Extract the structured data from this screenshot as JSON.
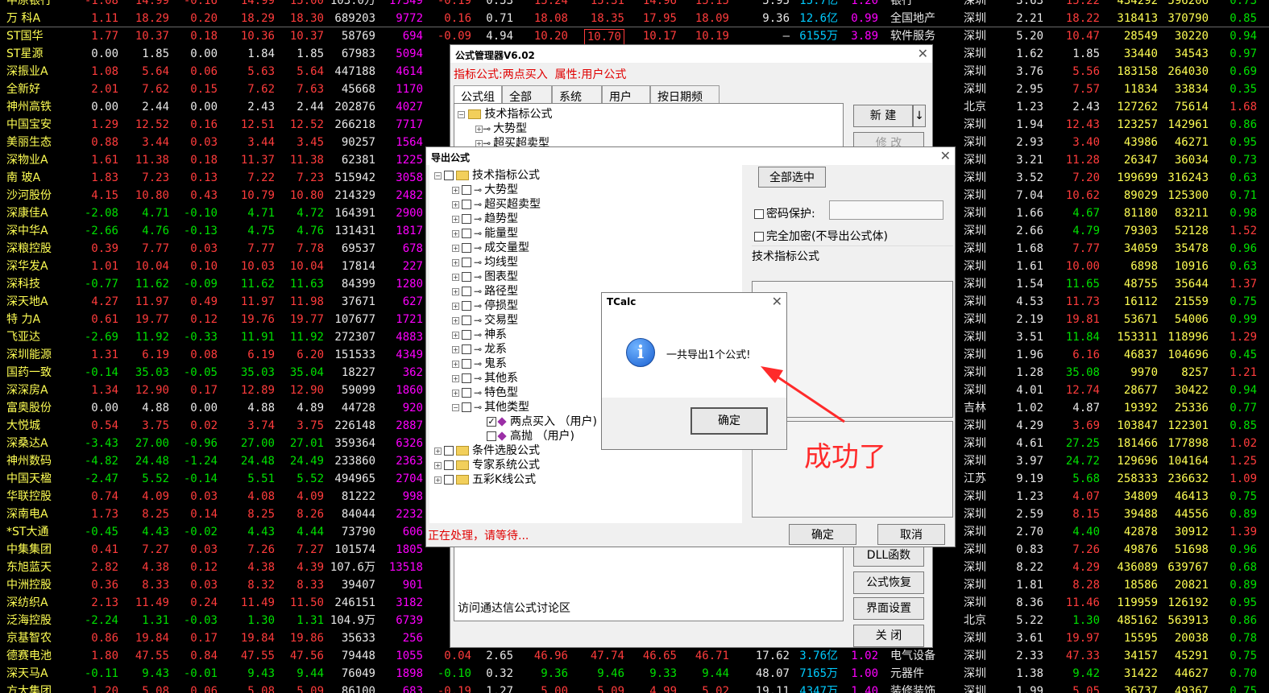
{
  "quotes": {
    "rows": [
      {
        "n": "中原银行",
        "v": [
          "-1.08",
          "14.99",
          "-0.16",
          "14.99",
          "15.00",
          "103.0万",
          "17349",
          "-0.19",
          "0.53",
          "15.24",
          "15.31",
          "14.96",
          "15.15",
          "5.95",
          "15.7亿",
          "1.20"
        ],
        "ind": "银行",
        "reg": "深圳",
        "t": [
          "3.63",
          "15.22",
          "434292",
          "596206",
          "0.73"
        ],
        "c": "r"
      },
      {
        "n": "万 科A",
        "v": [
          "1.11",
          "18.29",
          "0.20",
          "18.29",
          "18.30",
          "689203",
          "9772",
          "0.16",
          "0.71",
          "18.08",
          "18.35",
          "17.95",
          "18.09",
          "9.36",
          "12.6亿",
          "0.99"
        ],
        "ind": "全国地产",
        "reg": "深圳",
        "t": [
          "2.21",
          "18.22",
          "318413",
          "370790",
          "0.85"
        ],
        "c": "r"
      },
      {
        "n": "ST国华",
        "v": [
          "1.77",
          "10.37",
          "0.18",
          "10.36",
          "10.37",
          "58769",
          "694",
          "-0.09",
          "4.94",
          "10.20",
          "10.70",
          "10.17",
          "10.19",
          "—",
          "6155万",
          "3.89"
        ],
        "ind": "软件服务",
        "reg": "深圳",
        "t": [
          "5.20",
          "10.47",
          "28549",
          "30220",
          "0.94"
        ],
        "c": "r"
      },
      {
        "n": "ST星源",
        "v": [
          "0.00",
          "1.85",
          "0.00",
          "1.84",
          "1.85",
          "67983",
          "5094"
        ],
        "reg": "深圳",
        "t": [
          "1.62",
          "1.85",
          "33440",
          "34543",
          "0.97"
        ],
        "c": "w"
      },
      {
        "n": "深振业A",
        "v": [
          "1.08",
          "5.64",
          "0.06",
          "5.63",
          "5.64",
          "447188",
          "4614"
        ],
        "reg": "深圳",
        "t": [
          "3.76",
          "5.56",
          "183158",
          "264030",
          "0.69"
        ],
        "c": "r"
      },
      {
        "n": "全新好",
        "v": [
          "2.01",
          "7.62",
          "0.15",
          "7.62",
          "7.63",
          "45668",
          "1170"
        ],
        "reg": "深圳",
        "t": [
          "2.95",
          "7.57",
          "11834",
          "33834",
          "0.35"
        ],
        "c": "r"
      },
      {
        "n": "神州高铁",
        "v": [
          "0.00",
          "2.44",
          "0.00",
          "2.43",
          "2.44",
          "202876",
          "4027"
        ],
        "reg": "北京",
        "t": [
          "1.23",
          "2.43",
          "127262",
          "75614",
          "1.68"
        ],
        "c": "w"
      },
      {
        "n": "中国宝安",
        "v": [
          "1.29",
          "12.52",
          "0.16",
          "12.51",
          "12.52",
          "266218",
          "7717"
        ],
        "reg": "深圳",
        "t": [
          "1.94",
          "12.43",
          "123257",
          "142961",
          "0.86"
        ],
        "c": "r"
      },
      {
        "n": "美丽生态",
        "v": [
          "0.88",
          "3.44",
          "0.03",
          "3.44",
          "3.45",
          "90257",
          "1564"
        ],
        "reg": "深圳",
        "t": [
          "2.93",
          "3.40",
          "43986",
          "46271",
          "0.95"
        ],
        "c": "r"
      },
      {
        "n": "深物业A",
        "v": [
          "1.61",
          "11.38",
          "0.18",
          "11.37",
          "11.38",
          "62381",
          "1225"
        ],
        "reg": "深圳",
        "t": [
          "3.21",
          "11.28",
          "26347",
          "36034",
          "0.73"
        ],
        "c": "r"
      },
      {
        "n": "南 玻A",
        "v": [
          "1.83",
          "7.23",
          "0.13",
          "7.22",
          "7.23",
          "515942",
          "3058"
        ],
        "reg": "深圳",
        "t": [
          "3.52",
          "7.20",
          "199699",
          "316243",
          "0.63"
        ],
        "c": "r"
      },
      {
        "n": "沙河股份",
        "v": [
          "4.15",
          "10.80",
          "0.43",
          "10.79",
          "10.80",
          "214329",
          "2482"
        ],
        "reg": "深圳",
        "t": [
          "7.04",
          "10.62",
          "89029",
          "125300",
          "0.71"
        ],
        "c": "r"
      },
      {
        "n": "深康佳A",
        "v": [
          "-2.08",
          "4.71",
          "-0.10",
          "4.71",
          "4.72",
          "164391",
          "2900"
        ],
        "reg": "深圳",
        "t": [
          "1.66",
          "4.67",
          "81180",
          "83211",
          "0.98"
        ],
        "c": "g"
      },
      {
        "n": "深中华A",
        "v": [
          "-2.66",
          "4.76",
          "-0.13",
          "4.75",
          "4.76",
          "131431",
          "1817"
        ],
        "reg": "深圳",
        "t": [
          "2.66",
          "4.79",
          "79303",
          "52128",
          "1.52"
        ],
        "c": "g"
      },
      {
        "n": "深粮控股",
        "v": [
          "0.39",
          "7.77",
          "0.03",
          "7.77",
          "7.78",
          "69537",
          "678"
        ],
        "reg": "深圳",
        "t": [
          "1.68",
          "7.77",
          "34059",
          "35478",
          "0.96"
        ],
        "c": "r"
      },
      {
        "n": "深华发A",
        "v": [
          "1.01",
          "10.04",
          "0.10",
          "10.03",
          "10.04",
          "17814",
          "227"
        ],
        "reg": "深圳",
        "t": [
          "1.61",
          "10.00",
          "6898",
          "10916",
          "0.63"
        ],
        "c": "r"
      },
      {
        "n": "深科技",
        "v": [
          "-0.77",
          "11.62",
          "-0.09",
          "11.62",
          "11.63",
          "84399",
          "1280"
        ],
        "reg": "深圳",
        "t": [
          "1.54",
          "11.65",
          "48755",
          "35644",
          "1.37"
        ],
        "c": "g"
      },
      {
        "n": "深天地A",
        "v": [
          "4.27",
          "11.97",
          "0.49",
          "11.97",
          "11.98",
          "37671",
          "627"
        ],
        "reg": "深圳",
        "t": [
          "4.53",
          "11.73",
          "16112",
          "21559",
          "0.75"
        ],
        "c": "r"
      },
      {
        "n": "特 力A",
        "v": [
          "0.61",
          "19.77",
          "0.12",
          "19.76",
          "19.77",
          "107677",
          "1721"
        ],
        "reg": "深圳",
        "t": [
          "2.19",
          "19.81",
          "53671",
          "54006",
          "0.99"
        ],
        "c": "r"
      },
      {
        "n": "飞亚达",
        "v": [
          "-2.69",
          "11.92",
          "-0.33",
          "11.91",
          "11.92",
          "272307",
          "4883"
        ],
        "reg": "深圳",
        "t": [
          "3.51",
          "11.84",
          "153311",
          "118996",
          "1.29"
        ],
        "c": "g"
      },
      {
        "n": "深圳能源",
        "v": [
          "1.31",
          "6.19",
          "0.08",
          "6.19",
          "6.20",
          "151533",
          "4349"
        ],
        "reg": "深圳",
        "t": [
          "1.96",
          "6.16",
          "46837",
          "104696",
          "0.45"
        ],
        "c": "r"
      },
      {
        "n": "国药一致",
        "v": [
          "-0.14",
          "35.03",
          "-0.05",
          "35.03",
          "35.04",
          "18227",
          "362"
        ],
        "reg": "深圳",
        "t": [
          "1.28",
          "35.08",
          "9970",
          "8257",
          "1.21"
        ],
        "c": "g"
      },
      {
        "n": "深深房A",
        "v": [
          "1.34",
          "12.90",
          "0.17",
          "12.89",
          "12.90",
          "59099",
          "1860"
        ],
        "reg": "深圳",
        "t": [
          "4.01",
          "12.74",
          "28677",
          "30422",
          "0.94"
        ],
        "c": "r"
      },
      {
        "n": "富奥股份",
        "v": [
          "0.00",
          "4.88",
          "0.00",
          "4.88",
          "4.89",
          "44728",
          "920"
        ],
        "reg": "吉林",
        "t": [
          "1.02",
          "4.87",
          "19392",
          "25336",
          "0.77"
        ],
        "c": "w"
      },
      {
        "n": "大悦城",
        "v": [
          "0.54",
          "3.75",
          "0.02",
          "3.74",
          "3.75",
          "226148",
          "2887"
        ],
        "reg": "深圳",
        "t": [
          "4.29",
          "3.69",
          "103847",
          "122301",
          "0.85"
        ],
        "c": "r"
      },
      {
        "n": "深桑达A",
        "v": [
          "-3.43",
          "27.00",
          "-0.96",
          "27.00",
          "27.01",
          "359364",
          "6326"
        ],
        "reg": "深圳",
        "t": [
          "4.61",
          "27.25",
          "181466",
          "177898",
          "1.02"
        ],
        "c": "g"
      },
      {
        "n": "神州数码",
        "v": [
          "-4.82",
          "24.48",
          "-1.24",
          "24.48",
          "24.49",
          "233860",
          "2363"
        ],
        "reg": "深圳",
        "t": [
          "3.97",
          "24.72",
          "129696",
          "104164",
          "1.25"
        ],
        "c": "g"
      },
      {
        "n": "中国天楹",
        "v": [
          "-2.47",
          "5.52",
          "-0.14",
          "5.51",
          "5.52",
          "494965",
          "2704"
        ],
        "reg": "江苏",
        "t": [
          "9.19",
          "5.68",
          "258333",
          "236632",
          "1.09"
        ],
        "c": "g"
      },
      {
        "n": "华联控股",
        "v": [
          "0.74",
          "4.09",
          "0.03",
          "4.08",
          "4.09",
          "81222",
          "998"
        ],
        "reg": "深圳",
        "t": [
          "1.23",
          "4.07",
          "34809",
          "46413",
          "0.75"
        ],
        "c": "r"
      },
      {
        "n": "深南电A",
        "v": [
          "1.73",
          "8.25",
          "0.14",
          "8.25",
          "8.26",
          "84044",
          "2232"
        ],
        "reg": "深圳",
        "t": [
          "2.59",
          "8.15",
          "39488",
          "44556",
          "0.89"
        ],
        "c": "r"
      },
      {
        "n": "*ST大通",
        "v": [
          "-0.45",
          "4.43",
          "-0.02",
          "4.43",
          "4.44",
          "73790",
          "606"
        ],
        "reg": "深圳",
        "t": [
          "2.70",
          "4.40",
          "42878",
          "30912",
          "1.39"
        ],
        "c": "g"
      },
      {
        "n": "中集集团",
        "v": [
          "0.41",
          "7.27",
          "0.03",
          "7.26",
          "7.27",
          "101574",
          "1805"
        ],
        "reg": "深圳",
        "t": [
          "0.83",
          "7.26",
          "49876",
          "51698",
          "0.96"
        ],
        "c": "r"
      },
      {
        "n": "东旭蓝天",
        "v": [
          "2.82",
          "4.38",
          "0.12",
          "4.38",
          "4.39",
          "107.6万",
          "13518"
        ],
        "reg": "深圳",
        "t": [
          "8.22",
          "4.29",
          "436089",
          "639767",
          "0.68"
        ],
        "c": "r"
      },
      {
        "n": "中洲控股",
        "v": [
          "0.36",
          "8.33",
          "0.03",
          "8.32",
          "8.33",
          "39407",
          "901"
        ],
        "reg": "深圳",
        "t": [
          "1.81",
          "8.28",
          "18586",
          "20821",
          "0.89"
        ],
        "c": "r"
      },
      {
        "n": "深纺织A",
        "v": [
          "2.13",
          "11.49",
          "0.24",
          "11.49",
          "11.50",
          "246151",
          "3182"
        ],
        "reg": "深圳",
        "t": [
          "8.36",
          "11.46",
          "119959",
          "126192",
          "0.95"
        ],
        "c": "r"
      },
      {
        "n": "泛海控股",
        "v": [
          "-2.24",
          "1.31",
          "-0.03",
          "1.30",
          "1.31",
          "104.9万",
          "6739"
        ],
        "reg": "北京",
        "t": [
          "5.22",
          "1.30",
          "485162",
          "563913",
          "0.86"
        ],
        "c": "g"
      },
      {
        "n": "京基智农",
        "v": [
          "0.86",
          "19.84",
          "0.17",
          "19.84",
          "19.86",
          "35633",
          "256"
        ],
        "reg": "深圳",
        "t": [
          "3.61",
          "19.97",
          "15595",
          "20038",
          "0.78"
        ],
        "c": "r"
      },
      {
        "n": "德赛电池",
        "v": [
          "1.80",
          "47.55",
          "0.84",
          "47.55",
          "47.56",
          "79448",
          "1055",
          "0.04",
          "2.65",
          "46.96",
          "47.74",
          "46.65",
          "46.71",
          "17.62",
          "3.76亿",
          "1.02"
        ],
        "ind": "电气设备",
        "reg": "深圳",
        "t": [
          "2.33",
          "47.33",
          "34157",
          "45291",
          "0.75"
        ],
        "c": "r"
      },
      {
        "n": "深天马A",
        "v": [
          "-0.11",
          "9.43",
          "-0.01",
          "9.43",
          "9.44",
          "76049",
          "1898",
          "-0.10",
          "0.32",
          "9.36",
          "9.46",
          "9.33",
          "9.44",
          "48.07",
          "7165万",
          "1.00"
        ],
        "ind": "元器件",
        "reg": "深圳",
        "t": [
          "1.38",
          "9.42",
          "31422",
          "44627",
          "0.70"
        ],
        "c": "g"
      },
      {
        "n": "方大集团",
        "v": [
          "1.20",
          "5.08",
          "0.06",
          "5.08",
          "5.09",
          "86100",
          "683",
          "-0.19",
          "1.27",
          "5.00",
          "5.09",
          "4.99",
          "5.02",
          "19.11",
          "4347万",
          "1.40"
        ],
        "ind": "装修装饰",
        "reg": "深圳",
        "t": [
          "1.99",
          "5.05",
          "36737",
          "49367",
          "0.75"
        ],
        "c": "r"
      }
    ]
  },
  "formula_manager": {
    "title": "公式管理器V6.02",
    "info_label": "指标公式:",
    "info_value": "两点买入",
    "attr_label": "属性:",
    "attr_value": "用户公式",
    "tabs": [
      "公式组",
      "全部",
      "系统",
      "用户",
      "按日期频度"
    ],
    "tree": [
      "技术指标公式",
      "大势型",
      "超买超卖型"
    ],
    "buttons": {
      "new": "新  建",
      "arrow": "↓",
      "modify": "修  改",
      "dll": "DLL函数",
      "restore": "公式恢复",
      "ui": "界面设置",
      "close": "关  闭"
    },
    "footer_link": "访问通达信公式讨论区"
  },
  "export_dialog": {
    "title": "导出公式",
    "select_all": "全部选中",
    "password_label": "密码保护:",
    "full_encrypt_label": "完全加密(不导出公式体)",
    "desc": "技术指标公式",
    "status": "正在处理，请等待...",
    "ok": "确定",
    "cancel": "取消",
    "tree": {
      "root": "技术指标公式",
      "types": [
        "大势型",
        "超买超卖型",
        "趋势型",
        "能量型",
        "成交量型",
        "均线型",
        "图表型",
        "路径型",
        "停损型",
        "交易型",
        "神系",
        "龙系",
        "鬼系",
        "其他系",
        "特色型",
        "其他类型"
      ],
      "user_items": [
        {
          "label": "两点买入 （用户)",
          "checked": true
        },
        {
          "label": "高抛 （用户)",
          "checked": false
        }
      ],
      "others": [
        "条件选股公式",
        "专家系统公式",
        "五彩K线公式"
      ]
    }
  },
  "tcalc": {
    "title": "TCalc",
    "message": "一共导出1个公式!",
    "ok": "确定"
  },
  "annotation": {
    "text": "成功了",
    "color": "#ff2a2a"
  }
}
